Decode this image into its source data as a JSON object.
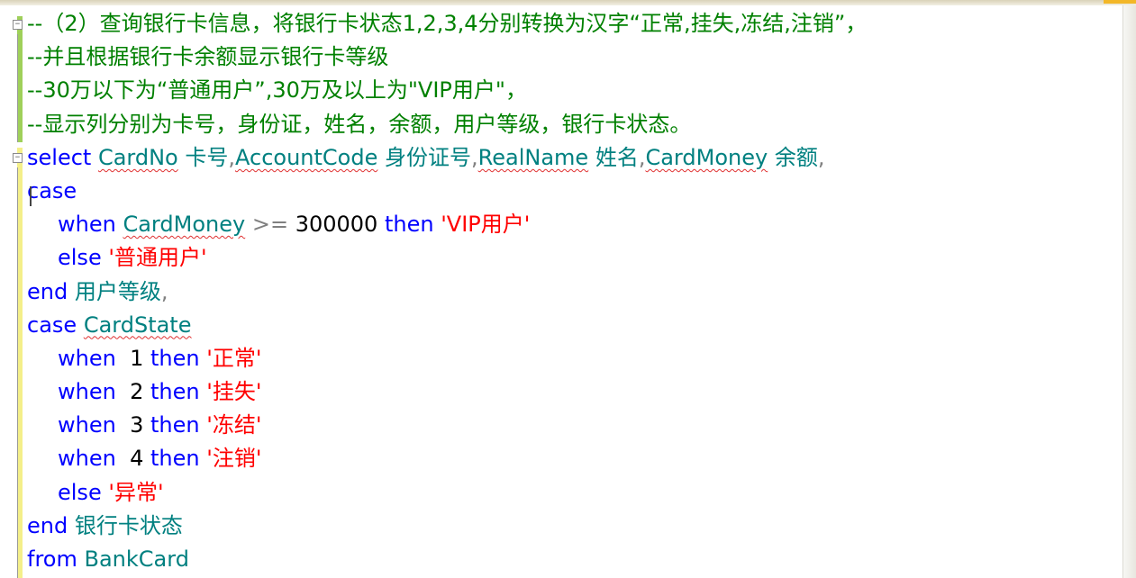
{
  "editor": {
    "comments": [
      "--（2）查询银行卡信息，将银行卡状态1,2,3,4分别转换为汉字“正常,挂失,冻结,注销”，",
      "--并且根据银行卡余额显示银行卡等级",
      "--30万以下为“普通用户”,30万及以上为\"VIP用户\"，",
      "--显示列分别为卡号，身份证，姓名，余额，用户等级，银行卡状态。"
    ],
    "select_kw": "select",
    "col1": "CardNo",
    "alias1": "卡号",
    "col2": "AccountCode",
    "alias2": "身份证号",
    "col3": "RealName",
    "alias3": "姓名",
    "col4": "CardMoney",
    "alias4": "余额",
    "comma": ",",
    "case_kw": "case",
    "when_kw": "when",
    "then_kw": "then",
    "else_kw": "else",
    "end_kw": "end",
    "from_kw": "from",
    "gte": ">=",
    "threshold": "300000",
    "vip_str": "'VIP用户'",
    "normal_user_str": "'普通用户'",
    "alias5": "用户等级",
    "case_col": "CardState",
    "state_cases": [
      {
        "num": "1",
        "str": "'正常'"
      },
      {
        "num": "2",
        "str": "'挂失'"
      },
      {
        "num": "3",
        "str": "'冻结'"
      },
      {
        "num": "4",
        "str": "'注销'"
      }
    ],
    "else_str": "'异常'",
    "alias6": "银行卡状态",
    "table": "BankCard"
  },
  "colors": {
    "comment": "#008000",
    "keyword": "#0000ff",
    "identifier": "#008080",
    "string": "#ff0000",
    "operator": "#808080",
    "changed_saved": "#9fd05a",
    "changed_unsaved": "#f4ef8a"
  }
}
